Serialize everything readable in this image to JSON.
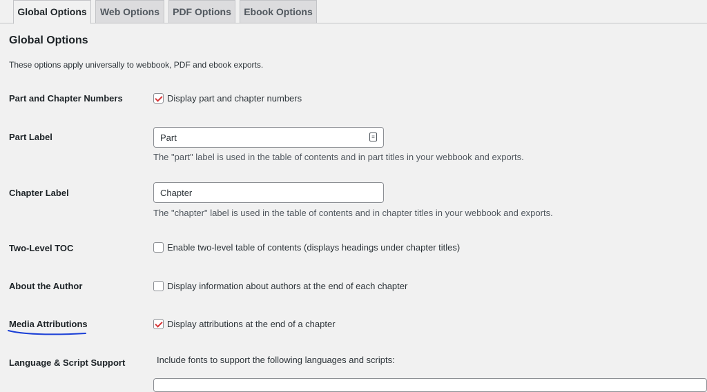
{
  "tabs": [
    {
      "label": "Global Options",
      "active": true
    },
    {
      "label": "Web Options",
      "active": false
    },
    {
      "label": "PDF Options",
      "active": false
    },
    {
      "label": "Ebook Options",
      "active": false
    }
  ],
  "section": {
    "title": "Global Options",
    "intro": "These options apply universally to webbook, PDF and ebook exports."
  },
  "rows": {
    "chapter_numbers": {
      "label": "Part and Chapter Numbers",
      "checkbox_label": "Display part and chapter numbers",
      "checked": true
    },
    "part_label": {
      "label": "Part Label",
      "value": "Part",
      "description": "The \"part\" label is used in the table of contents and in part titles in your webbook and exports.",
      "icon": "input-contact-icon"
    },
    "chapter_label": {
      "label": "Chapter Label",
      "value": "Chapter",
      "description": "The \"chapter\" label is used in the table of contents and in chapter titles in your webbook and exports."
    },
    "two_level_toc": {
      "label": "Two-Level TOC",
      "checkbox_label": "Enable two-level table of contents (displays headings under chapter titles)",
      "checked": false
    },
    "about_author": {
      "label": "About the Author",
      "checkbox_label": "Display information about authors at the end of each chapter",
      "checked": false
    },
    "media_attributions": {
      "label": "Media Attributions",
      "checkbox_label": "Display attributions at the end of a chapter",
      "checked": true
    },
    "language_support": {
      "label": "Language & Script Support",
      "description": "Include fonts to support the following languages and scripts:"
    }
  },
  "colors": {
    "checkmark": "#d63638",
    "annotation": "#1a3fd6",
    "background": "#f1f1f1"
  }
}
